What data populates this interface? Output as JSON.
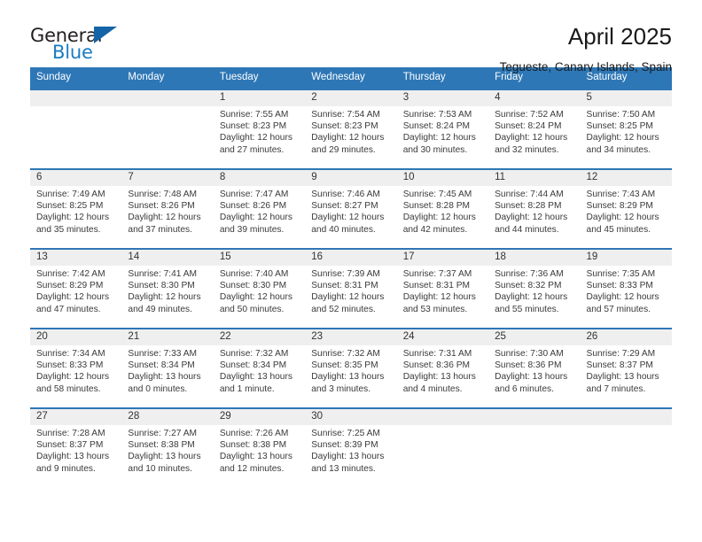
{
  "brand": {
    "line1": "General",
    "line2": "Blue",
    "triangle_color": "#1664a8"
  },
  "header": {
    "month_title": "April 2025",
    "location": "Tegueste, Canary Islands, Spain",
    "accent_color": "#2e77b6"
  },
  "calendar": {
    "weekday_headers": [
      "Sunday",
      "Monday",
      "Tuesday",
      "Wednesday",
      "Thursday",
      "Friday",
      "Saturday"
    ],
    "weeks": [
      [
        {
          "day": "",
          "sunrise": "",
          "sunset": "",
          "daylight_1": "",
          "daylight_2": ""
        },
        {
          "day": "",
          "sunrise": "",
          "sunset": "",
          "daylight_1": "",
          "daylight_2": ""
        },
        {
          "day": "1",
          "sunrise": "Sunrise: 7:55 AM",
          "sunset": "Sunset: 8:23 PM",
          "daylight_1": "Daylight: 12 hours",
          "daylight_2": "and 27 minutes."
        },
        {
          "day": "2",
          "sunrise": "Sunrise: 7:54 AM",
          "sunset": "Sunset: 8:23 PM",
          "daylight_1": "Daylight: 12 hours",
          "daylight_2": "and 29 minutes."
        },
        {
          "day": "3",
          "sunrise": "Sunrise: 7:53 AM",
          "sunset": "Sunset: 8:24 PM",
          "daylight_1": "Daylight: 12 hours",
          "daylight_2": "and 30 minutes."
        },
        {
          "day": "4",
          "sunrise": "Sunrise: 7:52 AM",
          "sunset": "Sunset: 8:24 PM",
          "daylight_1": "Daylight: 12 hours",
          "daylight_2": "and 32 minutes."
        },
        {
          "day": "5",
          "sunrise": "Sunrise: 7:50 AM",
          "sunset": "Sunset: 8:25 PM",
          "daylight_1": "Daylight: 12 hours",
          "daylight_2": "and 34 minutes."
        }
      ],
      [
        {
          "day": "6",
          "sunrise": "Sunrise: 7:49 AM",
          "sunset": "Sunset: 8:25 PM",
          "daylight_1": "Daylight: 12 hours",
          "daylight_2": "and 35 minutes."
        },
        {
          "day": "7",
          "sunrise": "Sunrise: 7:48 AM",
          "sunset": "Sunset: 8:26 PM",
          "daylight_1": "Daylight: 12 hours",
          "daylight_2": "and 37 minutes."
        },
        {
          "day": "8",
          "sunrise": "Sunrise: 7:47 AM",
          "sunset": "Sunset: 8:26 PM",
          "daylight_1": "Daylight: 12 hours",
          "daylight_2": "and 39 minutes."
        },
        {
          "day": "9",
          "sunrise": "Sunrise: 7:46 AM",
          "sunset": "Sunset: 8:27 PM",
          "daylight_1": "Daylight: 12 hours",
          "daylight_2": "and 40 minutes."
        },
        {
          "day": "10",
          "sunrise": "Sunrise: 7:45 AM",
          "sunset": "Sunset: 8:28 PM",
          "daylight_1": "Daylight: 12 hours",
          "daylight_2": "and 42 minutes."
        },
        {
          "day": "11",
          "sunrise": "Sunrise: 7:44 AM",
          "sunset": "Sunset: 8:28 PM",
          "daylight_1": "Daylight: 12 hours",
          "daylight_2": "and 44 minutes."
        },
        {
          "day": "12",
          "sunrise": "Sunrise: 7:43 AM",
          "sunset": "Sunset: 8:29 PM",
          "daylight_1": "Daylight: 12 hours",
          "daylight_2": "and 45 minutes."
        }
      ],
      [
        {
          "day": "13",
          "sunrise": "Sunrise: 7:42 AM",
          "sunset": "Sunset: 8:29 PM",
          "daylight_1": "Daylight: 12 hours",
          "daylight_2": "and 47 minutes."
        },
        {
          "day": "14",
          "sunrise": "Sunrise: 7:41 AM",
          "sunset": "Sunset: 8:30 PM",
          "daylight_1": "Daylight: 12 hours",
          "daylight_2": "and 49 minutes."
        },
        {
          "day": "15",
          "sunrise": "Sunrise: 7:40 AM",
          "sunset": "Sunset: 8:30 PM",
          "daylight_1": "Daylight: 12 hours",
          "daylight_2": "and 50 minutes."
        },
        {
          "day": "16",
          "sunrise": "Sunrise: 7:39 AM",
          "sunset": "Sunset: 8:31 PM",
          "daylight_1": "Daylight: 12 hours",
          "daylight_2": "and 52 minutes."
        },
        {
          "day": "17",
          "sunrise": "Sunrise: 7:37 AM",
          "sunset": "Sunset: 8:31 PM",
          "daylight_1": "Daylight: 12 hours",
          "daylight_2": "and 53 minutes."
        },
        {
          "day": "18",
          "sunrise": "Sunrise: 7:36 AM",
          "sunset": "Sunset: 8:32 PM",
          "daylight_1": "Daylight: 12 hours",
          "daylight_2": "and 55 minutes."
        },
        {
          "day": "19",
          "sunrise": "Sunrise: 7:35 AM",
          "sunset": "Sunset: 8:33 PM",
          "daylight_1": "Daylight: 12 hours",
          "daylight_2": "and 57 minutes."
        }
      ],
      [
        {
          "day": "20",
          "sunrise": "Sunrise: 7:34 AM",
          "sunset": "Sunset: 8:33 PM",
          "daylight_1": "Daylight: 12 hours",
          "daylight_2": "and 58 minutes."
        },
        {
          "day": "21",
          "sunrise": "Sunrise: 7:33 AM",
          "sunset": "Sunset: 8:34 PM",
          "daylight_1": "Daylight: 13 hours",
          "daylight_2": "and 0 minutes."
        },
        {
          "day": "22",
          "sunrise": "Sunrise: 7:32 AM",
          "sunset": "Sunset: 8:34 PM",
          "daylight_1": "Daylight: 13 hours",
          "daylight_2": "and 1 minute."
        },
        {
          "day": "23",
          "sunrise": "Sunrise: 7:32 AM",
          "sunset": "Sunset: 8:35 PM",
          "daylight_1": "Daylight: 13 hours",
          "daylight_2": "and 3 minutes."
        },
        {
          "day": "24",
          "sunrise": "Sunrise: 7:31 AM",
          "sunset": "Sunset: 8:36 PM",
          "daylight_1": "Daylight: 13 hours",
          "daylight_2": "and 4 minutes."
        },
        {
          "day": "25",
          "sunrise": "Sunrise: 7:30 AM",
          "sunset": "Sunset: 8:36 PM",
          "daylight_1": "Daylight: 13 hours",
          "daylight_2": "and 6 minutes."
        },
        {
          "day": "26",
          "sunrise": "Sunrise: 7:29 AM",
          "sunset": "Sunset: 8:37 PM",
          "daylight_1": "Daylight: 13 hours",
          "daylight_2": "and 7 minutes."
        }
      ],
      [
        {
          "day": "27",
          "sunrise": "Sunrise: 7:28 AM",
          "sunset": "Sunset: 8:37 PM",
          "daylight_1": "Daylight: 13 hours",
          "daylight_2": "and 9 minutes."
        },
        {
          "day": "28",
          "sunrise": "Sunrise: 7:27 AM",
          "sunset": "Sunset: 8:38 PM",
          "daylight_1": "Daylight: 13 hours",
          "daylight_2": "and 10 minutes."
        },
        {
          "day": "29",
          "sunrise": "Sunrise: 7:26 AM",
          "sunset": "Sunset: 8:38 PM",
          "daylight_1": "Daylight: 13 hours",
          "daylight_2": "and 12 minutes."
        },
        {
          "day": "30",
          "sunrise": "Sunrise: 7:25 AM",
          "sunset": "Sunset: 8:39 PM",
          "daylight_1": "Daylight: 13 hours",
          "daylight_2": "and 13 minutes."
        },
        {
          "day": "",
          "sunrise": "",
          "sunset": "",
          "daylight_1": "",
          "daylight_2": ""
        },
        {
          "day": "",
          "sunrise": "",
          "sunset": "",
          "daylight_1": "",
          "daylight_2": ""
        },
        {
          "day": "",
          "sunrise": "",
          "sunset": "",
          "daylight_1": "",
          "daylight_2": ""
        }
      ]
    ]
  }
}
